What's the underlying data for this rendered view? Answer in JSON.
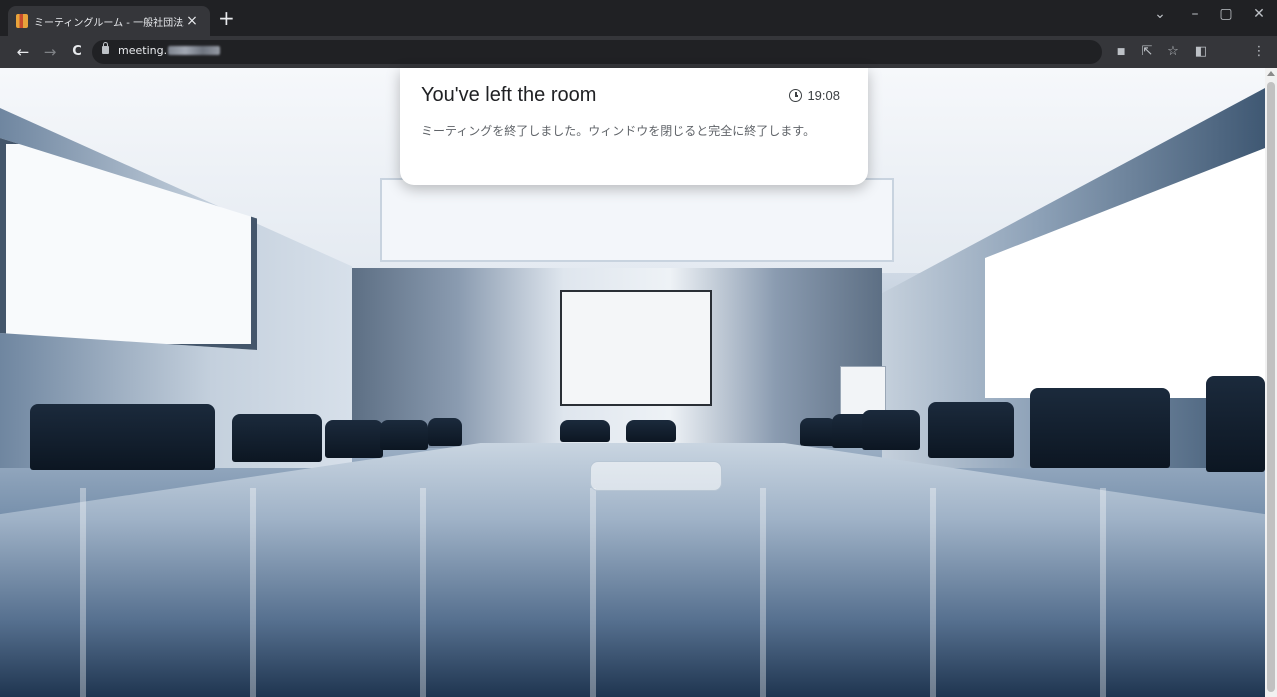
{
  "browser": {
    "tab": {
      "title": "ミーティングルーム - 一般社団法人日",
      "close": "×"
    },
    "new_tab": "+",
    "window_controls": {
      "tabsearch": "⌄",
      "minimize": "–",
      "restore": "▢",
      "close": "✕"
    },
    "nav": {
      "back": "←",
      "forward": "→",
      "reload": "C"
    },
    "address": {
      "url_prefix": "meeting."
    },
    "toolbar_icons": {
      "camera": "■",
      "share": "⇱",
      "bookmark": "☆",
      "sidepanel": "◧",
      "menu": "⋮"
    }
  },
  "notification": {
    "title": "You've left the room",
    "time": "19:08",
    "message": "ミーティングを終了しました。ウィンドウを閉じると完全に終了します。"
  }
}
